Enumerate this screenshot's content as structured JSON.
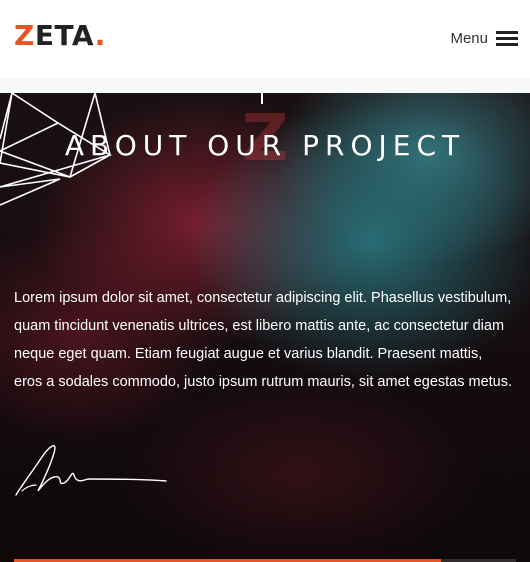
{
  "header": {
    "logo_prefix": "Z",
    "logo_rest": "ETA",
    "logo_dot": ".",
    "menu_label": "Menu"
  },
  "hero": {
    "watermark": "Z",
    "title": "ABOUT OUR PROJECT",
    "paragraph": "Lorem ipsum dolor sit amet, consectetur adipiscing elit. Phasellus vestibulum, quam tincidunt venenatis ultrices, est libero mattis ante, ac consectetur diam neque eget quam. Etiam feugiat augue et varius blandit. Praesent mattis, eros a sodales commodo, justo ipsum rutrum mauris, sit amet egestas metus.",
    "scroll_progress": 0.85
  },
  "colors": {
    "accent": "#e8541f",
    "text_dark": "#222222"
  },
  "icons": {
    "menu": "hamburger-icon",
    "signature": "signature-icon"
  }
}
